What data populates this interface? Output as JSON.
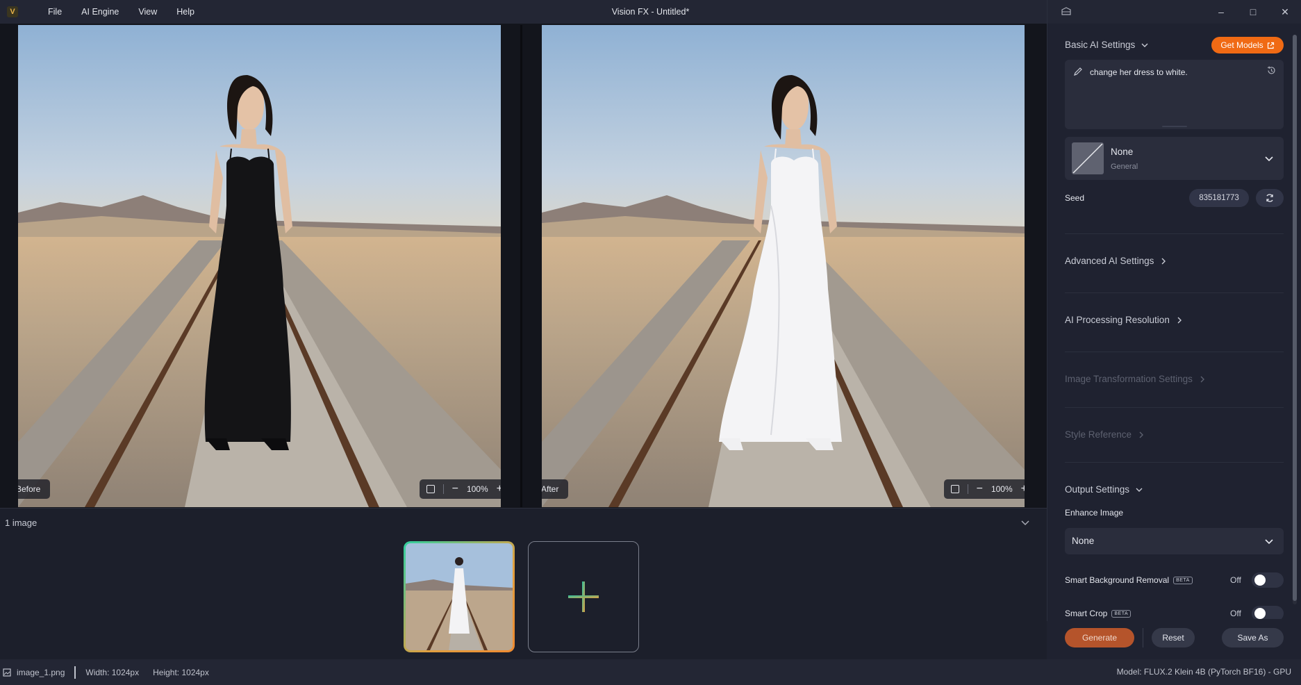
{
  "app": {
    "title": "Vision FX - Untitled*",
    "logo_letter": "V",
    "menu": [
      "File",
      "AI Engine",
      "View",
      "Help"
    ]
  },
  "canvas": {
    "before_label": "Before",
    "after_label": "After",
    "zoom_left": "100%",
    "zoom_right": "100%"
  },
  "filmstrip": {
    "count_label": "1 image"
  },
  "status": {
    "filename": "image_1.png",
    "width": "Width: 1024px",
    "height": "Height: 1024px",
    "model": "Model: FLUX.2 Klein 4B (PyTorch BF16) - GPU"
  },
  "side": {
    "basic_header": "Basic AI Settings",
    "get_models": "Get Models",
    "prompt": "change her dress to white.",
    "model_name": "None",
    "model_sub": "General",
    "seed_label": "Seed",
    "seed_value": "835181773",
    "advanced_header": "Advanced AI Settings",
    "resolution_header": "AI Processing Resolution",
    "transform_header": "Image Transformation Settings",
    "style_header": "Style Reference",
    "output_header": "Output Settings",
    "enhance_label": "Enhance Image",
    "enhance_value": "None",
    "sbr_label": "Smart Background Removal",
    "sbr_state": "Off",
    "crop_label": "Smart Crop",
    "crop_state": "Off",
    "beta": "BETA",
    "generate": "Generate",
    "reset": "Reset",
    "save_as": "Save As"
  },
  "colors": {
    "accent": "#f06a14",
    "generate": "#b5542b",
    "background": "#1a1d27"
  }
}
